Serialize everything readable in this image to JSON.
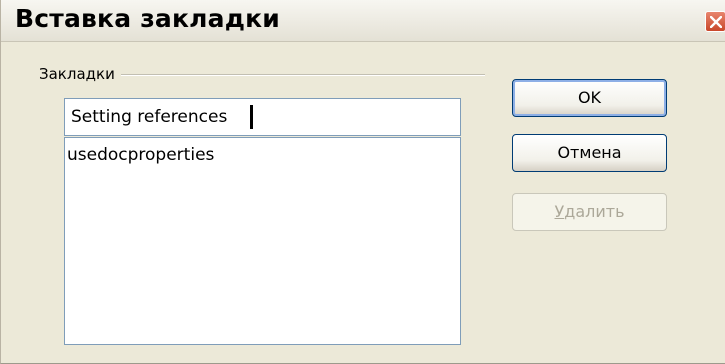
{
  "window": {
    "title": "Вставка закладки",
    "close_icon": "close-icon"
  },
  "bookmarks": {
    "group_label": "Закладки",
    "name_value": "Setting references",
    "items": [
      "usedocproperties"
    ]
  },
  "buttons": {
    "ok_label": "OK",
    "cancel_label": "Отмена",
    "delete_label": "Удалить"
  },
  "colors": {
    "dialog_bg": "#ece9d8",
    "close_button": "#c9472a",
    "border": "#7f9db9"
  }
}
